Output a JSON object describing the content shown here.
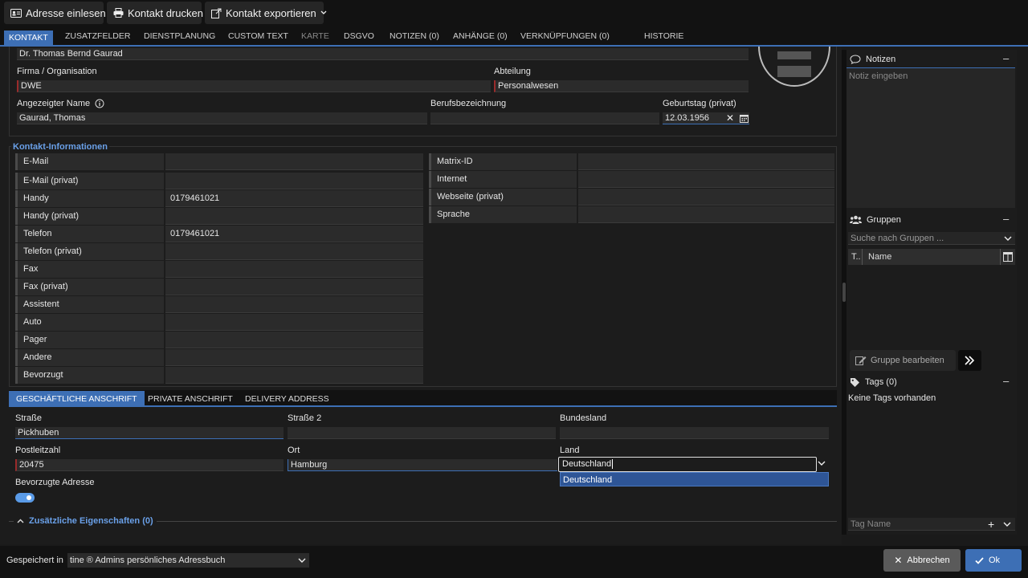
{
  "toolbar": {
    "read_address": "Adresse einlesen",
    "print_contact": "Kontakt drucken",
    "export_contact": "Kontakt exportieren"
  },
  "tabs": [
    {
      "label": "KONTAKT"
    },
    {
      "label": "ZUSATZFELDER"
    },
    {
      "label": "DIENSTPLANUNG"
    },
    {
      "label": "CUSTOM TEXT"
    },
    {
      "label": "KARTE"
    },
    {
      "label": "DSGVO"
    },
    {
      "label": "NOTIZEN (0)"
    },
    {
      "label": "ANHÄNGE (0)"
    },
    {
      "label": "VERKNÜPFUNGEN (0)"
    },
    {
      "label": "HISTORIE"
    }
  ],
  "person": {
    "full_name": "Dr. Thomas Bernd Gaurad",
    "company_label": "Firma / Organisation",
    "company": "DWE",
    "department_label": "Abteilung",
    "department": "Personalwesen",
    "display_name_label": "Angezeigter Name",
    "display_name": "Gaurad, Thomas",
    "job_title_label": "Berufsbezeichnung",
    "job_title": "",
    "birthday_label": "Geburtstag (privat)",
    "birthday": "12.03.1956"
  },
  "contact_info": {
    "title": "Kontakt-Informationen",
    "left": [
      {
        "label": "E-Mail",
        "value": ""
      },
      {
        "label": "E-Mail (privat)",
        "value": ""
      },
      {
        "label": "Handy",
        "value": "0179461021"
      },
      {
        "label": "Handy (privat)",
        "value": ""
      },
      {
        "label": "Telefon",
        "value": "0179461021"
      },
      {
        "label": "Telefon (privat)",
        "value": ""
      },
      {
        "label": "Fax",
        "value": ""
      },
      {
        "label": "Fax (privat)",
        "value": ""
      },
      {
        "label": "Assistent",
        "value": ""
      },
      {
        "label": "Auto",
        "value": ""
      },
      {
        "label": "Pager",
        "value": ""
      },
      {
        "label": "Andere",
        "value": ""
      },
      {
        "label": "Bevorzugt",
        "value": ""
      }
    ],
    "right": [
      {
        "label": "Matrix-ID",
        "value": ""
      },
      {
        "label": "Internet",
        "value": ""
      },
      {
        "label": "Webseite (privat)",
        "value": ""
      },
      {
        "label": "Sprache",
        "value": ""
      }
    ]
  },
  "address_tabs": [
    {
      "label": "GESCHÄFTLICHE ANSCHRIFT"
    },
    {
      "label": "PRIVATE ANSCHRIFT"
    },
    {
      "label": "DELIVERY ADDRESS"
    }
  ],
  "address": {
    "street_label": "Straße",
    "street": "Pickhuben",
    "street2_label": "Straße 2",
    "street2": "",
    "state_label": "Bundesland",
    "state": "",
    "zip_label": "Postleitzahl",
    "zip": "20475",
    "city_label": "Ort",
    "city": "Hamburg",
    "country_label": "Land",
    "country": "Deutschland",
    "country_option": "Deutschland",
    "preferred_label": "Bevorzugte Adresse"
  },
  "extra_props": "Zusätzliche Eigenschaften (0)",
  "notes": {
    "title": "Notizen",
    "placeholder": "Notiz eingeben"
  },
  "groups": {
    "title": "Gruppen",
    "search_placeholder": "Suche nach Gruppen ...",
    "col_type": "T..",
    "col_name": "Name",
    "edit_button": "Gruppe bearbeiten"
  },
  "tags": {
    "title": "Tags (0)",
    "empty": "Keine Tags vorhanden",
    "name_placeholder": "Tag Name"
  },
  "footer": {
    "saved_in_label": "Gespeichert in",
    "saved_in_value": "tine ® Admins persönliches Adressbuch",
    "cancel": "Abbrechen",
    "ok": "Ok"
  },
  "colors": {
    "accent": "#3d6fb5",
    "section_title": "#6aa0e8",
    "required_marker": "#9a2b2b"
  }
}
